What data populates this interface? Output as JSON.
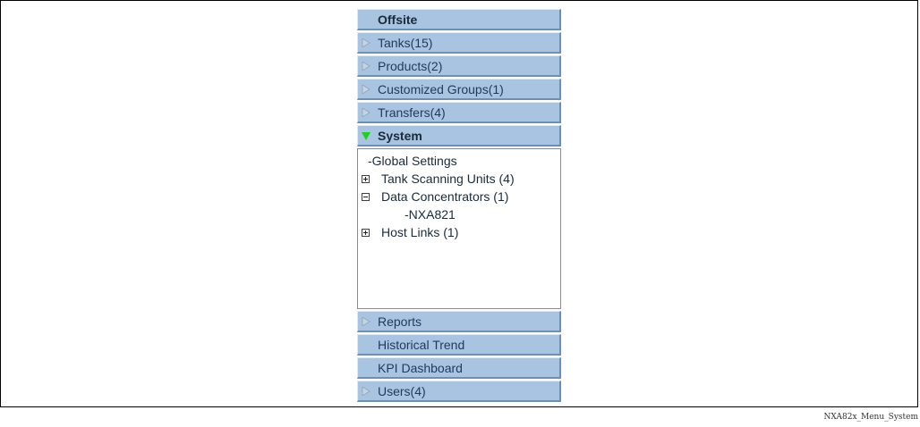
{
  "menu": {
    "header": "Offsite",
    "items_top": [
      {
        "label": "Tanks(15)",
        "icon": "expand-arrow-icon"
      },
      {
        "label": "Products(2)",
        "icon": "expand-arrow-icon"
      },
      {
        "label": "Customized Groups(1)",
        "icon": "expand-arrow-icon"
      },
      {
        "label": "Transfers(4)",
        "icon": "expand-arrow-icon"
      }
    ],
    "open_section": {
      "label": "System",
      "icon": "collapse-arrow-icon",
      "icon_color": "#22cc22"
    },
    "tree": [
      {
        "label": "-Global Settings"
      },
      {
        "label": "Tank Scanning Units (4)",
        "icon": "plus-box-icon"
      },
      {
        "label": "Data Concentrators (1)",
        "icon": "minus-box-icon"
      },
      {
        "label": "-NXA821"
      },
      {
        "label": "Host Links (1)",
        "icon": "plus-box-icon"
      }
    ],
    "items_bottom": [
      {
        "label": "Reports",
        "icon": "expand-arrow-icon"
      },
      {
        "label": "Historical Trend"
      },
      {
        "label": "KPI Dashboard"
      },
      {
        "label": "Users(4)",
        "icon": "expand-arrow-icon"
      }
    ]
  },
  "caption": "NXA82x_Menu_System",
  "colors": {
    "button_bg": "#a8c4e0",
    "button_text": "#1d3a5c",
    "open_arrow": "#22cc22",
    "closed_arrow": "#b8c8d8"
  }
}
